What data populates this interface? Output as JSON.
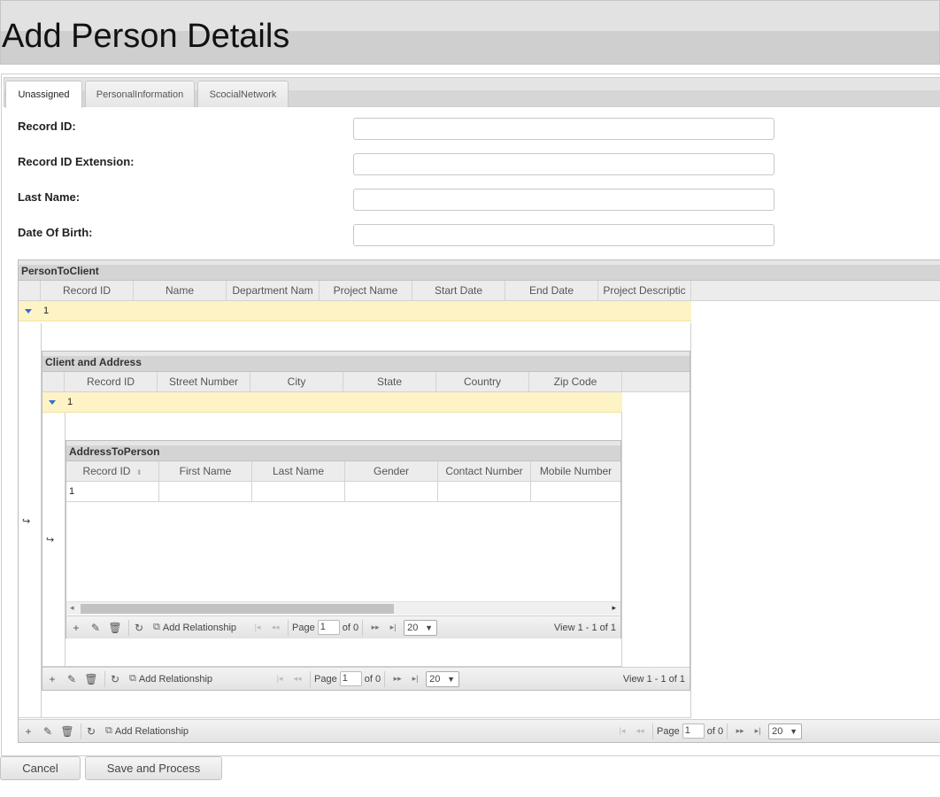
{
  "header": {
    "title": "Add Person Details"
  },
  "tabs": [
    {
      "label": "Unassigned",
      "active": true
    },
    {
      "label": "PersonalInformation",
      "active": false
    },
    {
      "label": "ScocialNetwork",
      "active": false
    }
  ],
  "form": {
    "fields": [
      {
        "label": "Record ID:",
        "value": ""
      },
      {
        "label": "Record ID Extension:",
        "value": ""
      },
      {
        "label": "Last Name:",
        "value": ""
      },
      {
        "label": "Date Of Birth:",
        "value": ""
      }
    ]
  },
  "grid_person_to_client": {
    "caption": "PersonToClient",
    "columns": [
      "Record ID",
      "Name",
      "Department Nam",
      "Project Name",
      "Start Date",
      "End Date",
      "Project Descriptic"
    ],
    "row_value": "1",
    "subgrid_icon": "subgrid-arrow-icon",
    "pager": {
      "add_relationship": "Add Relationship",
      "page_label": "Page",
      "page_value": "1",
      "of_label": "of 0",
      "rows_per_page": "20"
    }
  },
  "grid_client_address": {
    "caption": "Client and Address",
    "columns": [
      "Record ID",
      "Street Number",
      "City",
      "State",
      "Country",
      "Zip Code"
    ],
    "row_value": "1",
    "subgrid_icon": "subgrid-arrow-icon",
    "pager": {
      "add_relationship": "Add Relationship",
      "page_label": "Page",
      "page_value": "1",
      "of_label": "of 0",
      "rows_per_page": "20",
      "view_info": "View 1 - 1 of 1"
    }
  },
  "grid_address_person": {
    "caption": "AddressToPerson",
    "columns": [
      "Record ID",
      "First Name",
      "Last Name",
      "Gender",
      "Contact Number",
      "Mobile Number"
    ],
    "row_value": "1",
    "pager": {
      "add_relationship": "Add Relationship",
      "page_label": "Page",
      "page_value": "1",
      "of_label": "of 0",
      "rows_per_page": "20",
      "view_info": "View 1 - 1 of 1"
    }
  },
  "actions": {
    "cancel": "Cancel",
    "save": "Save and Process"
  },
  "colors": {
    "row_highlight": "#fdf3c4",
    "expand_icon": "#2e6fd1",
    "header_bg": "#d4d4d4"
  }
}
